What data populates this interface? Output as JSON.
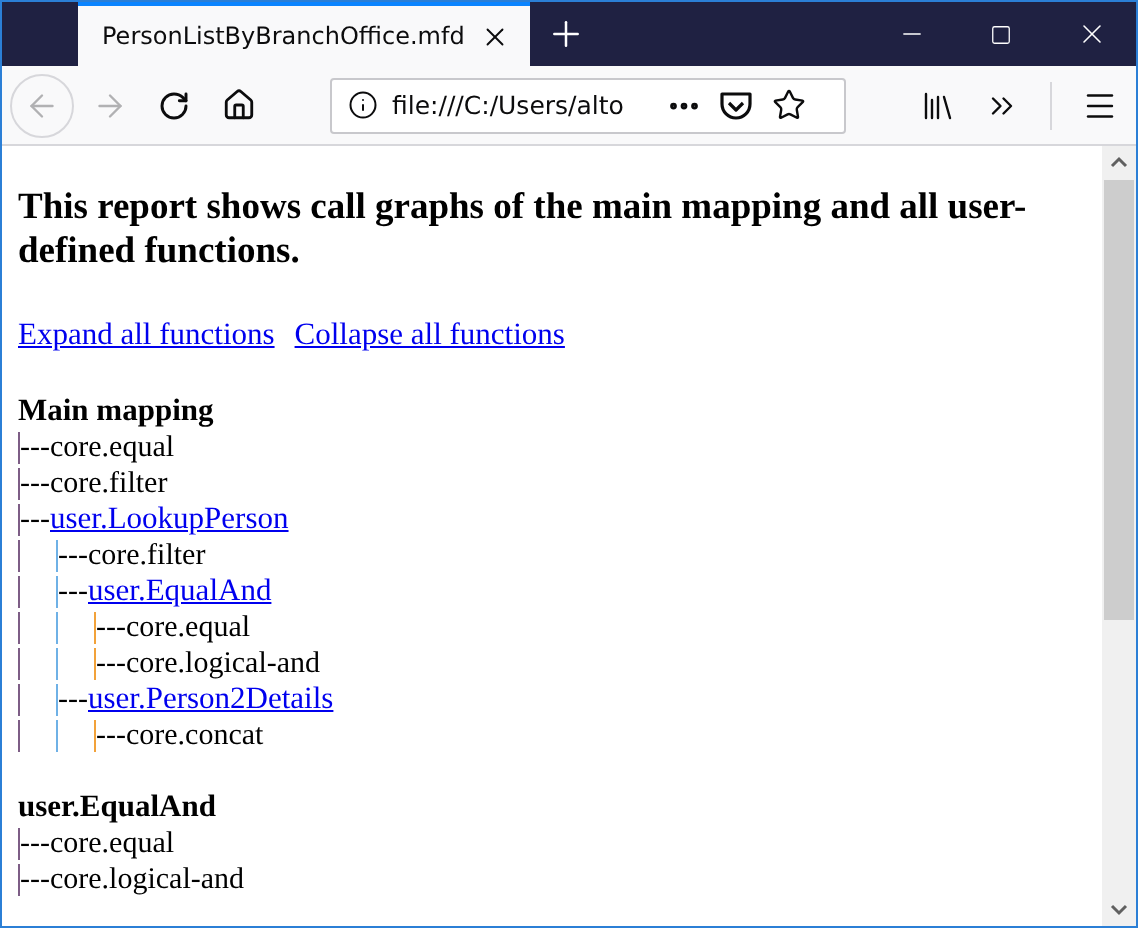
{
  "browser": {
    "tab_title": "PersonListByBranchOffice.mfd",
    "url": "file:///C:/Users/alto"
  },
  "page": {
    "heading": "This report shows call graphs of the main mapping and all user-defined functions.",
    "actions": [
      "Expand all functions",
      "Collapse all functions"
    ],
    "connector": "---",
    "sections": [
      {
        "title": "Main mapping",
        "calls": [
          {
            "name": "core.equal",
            "kind": "text"
          },
          {
            "name": "core.filter",
            "kind": "text"
          },
          {
            "name": "user.LookupPerson",
            "kind": "link",
            "children": [
              {
                "name": "core.filter",
                "kind": "text"
              },
              {
                "name": "user.EqualAnd",
                "kind": "link",
                "children": [
                  {
                    "name": "core.equal",
                    "kind": "text"
                  },
                  {
                    "name": "core.logical-and",
                    "kind": "text"
                  }
                ]
              },
              {
                "name": "user.Person2Details",
                "kind": "link",
                "children": [
                  {
                    "name": "core.concat",
                    "kind": "text"
                  }
                ]
              }
            ]
          }
        ]
      },
      {
        "title": "user.EqualAnd",
        "calls": [
          {
            "name": "core.equal",
            "kind": "text"
          },
          {
            "name": "core.logical-and",
            "kind": "text"
          }
        ]
      }
    ]
  }
}
